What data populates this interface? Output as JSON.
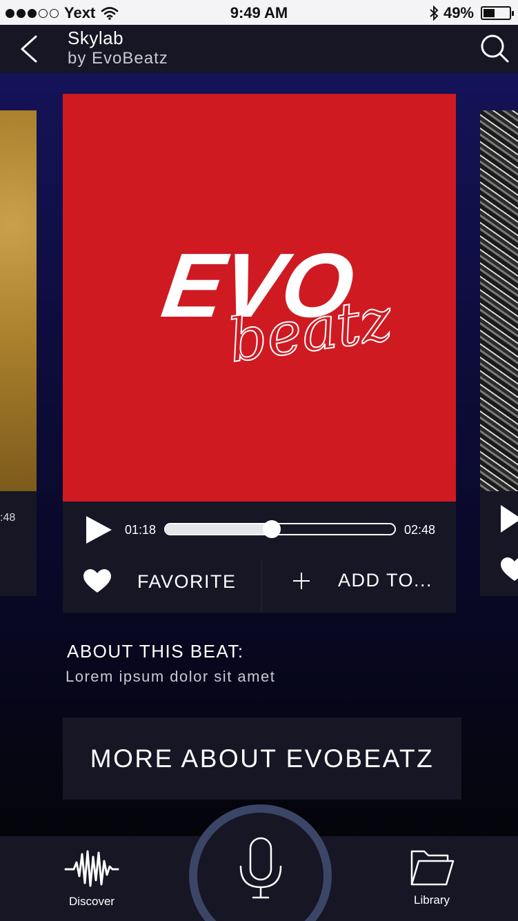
{
  "status_bar": {
    "carrier": "Yext",
    "time": "9:49 AM",
    "battery": "49%",
    "battery_level": 0.49
  },
  "nav": {
    "title": "Skylab",
    "subtitle": "by EvoBeatz",
    "back_icon": "chevron-left-icon",
    "search_icon": "search-icon"
  },
  "carousel": {
    "left_card_time": ":48"
  },
  "player": {
    "logo_main": "EVO",
    "logo_script": "beatz",
    "current_time": "01:18",
    "total_time": "02:48",
    "progress": 0.464,
    "favorite_label": "FAVORITE",
    "add_label": "ADD TO..."
  },
  "about": {
    "title": "ABOUT THIS BEAT:",
    "text": "Lorem ipsum dolor sit amet"
  },
  "more_button": "MORE ABOUT EVOBEATZ",
  "tabs": {
    "discover": "Discover",
    "library": "Library"
  },
  "colors": {
    "art_red": "#cf1a22",
    "panel": "#161625",
    "mic_ring": "#3b4566"
  }
}
